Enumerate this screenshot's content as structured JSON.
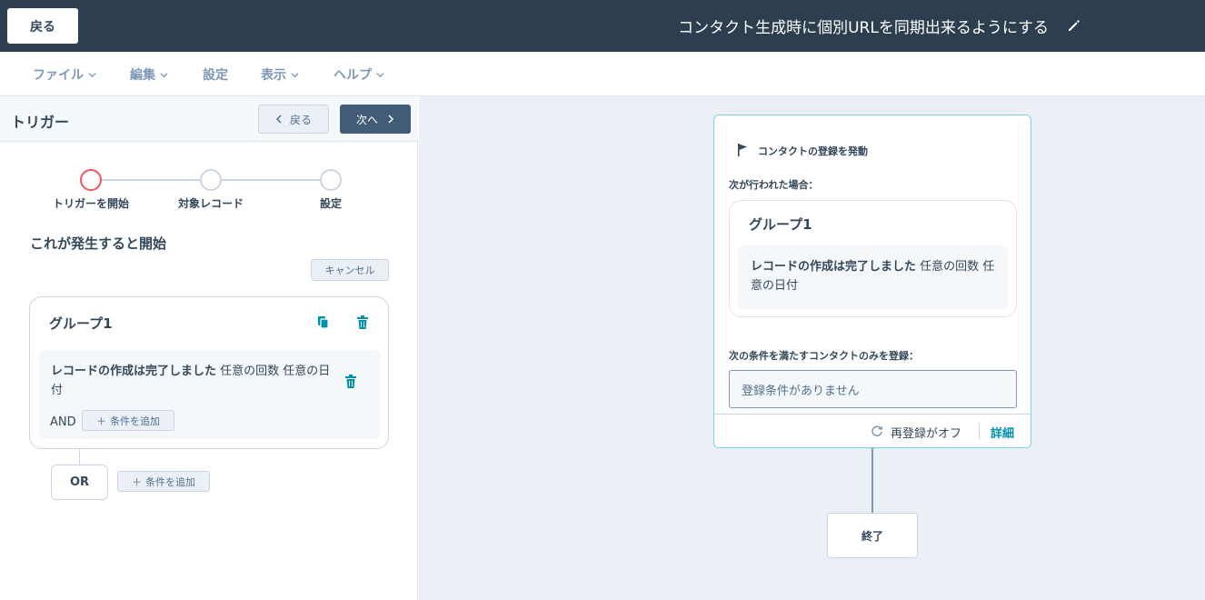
{
  "header": {
    "back_label": "戻る",
    "title": "コンタクト生成時に個別URLを同期出来るようにする",
    "edit_icon": "pencil-icon"
  },
  "menu": {
    "items": [
      {
        "label": "ファイル",
        "has_dropdown": true
      },
      {
        "label": "編集",
        "has_dropdown": true
      },
      {
        "label": "設定",
        "has_dropdown": false
      },
      {
        "label": "表示",
        "has_dropdown": true
      },
      {
        "label": "ヘルプ",
        "has_dropdown": true
      }
    ]
  },
  "panel": {
    "title": "トリガー",
    "prev_label": "戻る",
    "next_label": "次へ",
    "steps": [
      {
        "label": "トリガーを開始",
        "active": true
      },
      {
        "label": "対象レコード",
        "active": false
      },
      {
        "label": "設定",
        "active": false
      }
    ],
    "section_title": "これが発生すると開始",
    "cancel_label": "キャンセル",
    "group": {
      "title": "グループ1",
      "condition_bold": "レコードの作成は完了しました",
      "condition_rest": " 任意の回数 任意の日付",
      "and_label": "AND",
      "add_condition_label": "条件を追加"
    },
    "or_label": "OR",
    "or_add_condition_label": "条件を追加"
  },
  "canvas": {
    "trigger_title": "コンタクトの登録を発動",
    "when_label": "次が行われた場合：",
    "group_title": "グループ1",
    "condition_bold": "レコードの作成は完了しました",
    "condition_rest": " 任意の回数 任意の日付",
    "enroll_label": "次の条件を満たすコンタクトのみを登録：",
    "enroll_value": "登録条件がありません",
    "reenroll_text": "再登録がオフ",
    "details_label": "詳細",
    "end_label": "終了"
  },
  "colors": {
    "header_bg": "#2d3e50",
    "active_step": "#f2545b",
    "link": "#0091ae",
    "trash": "#0091ae",
    "card_border": "#7fd1de"
  }
}
